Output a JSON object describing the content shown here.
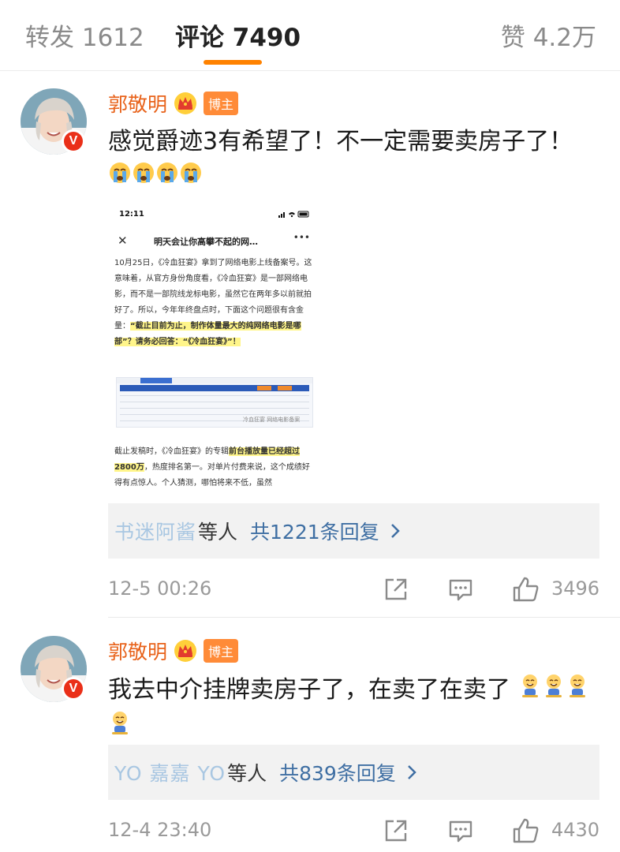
{
  "tabs": {
    "repost": "转发 1612",
    "comments": "评论 7490",
    "likes": "赞 4.2万",
    "active": "comments"
  },
  "comments": [
    {
      "username": "郭敬明",
      "badge": "博主",
      "text": "感觉爵迹3有希望了！不一定需要卖房子了！",
      "emoji_count": 4,
      "emoji_type": "crying-face",
      "image": {
        "status_time": "12:11",
        "nav_title": "明天会让你高攀不起的网…",
        "para1": "10月25日，《冷血狂宴》拿到了网络电影上线备案号。这意味着，从官方身份角度看，《冷血狂宴》是一部网络电影，而不是一部院线龙标电影，虽然它在两年多以前就拍好了。所以，今年年终盘点时，下面这个问题很有含金量：",
        "para1_highlight": "“截止目前为止，制作体量最大的纯网络电影是哪部”？请务必回答：“《冷血狂宴》”！",
        "web_caption": "冷血狂宴 网络电影备案",
        "para2_a": "截止发稿时，《冷血狂宴》的专辑",
        "para2_highlight": "前台播放量已经超过2800万",
        "para2_b": "，热度排名第一。对单片付费来说，这个成绩好得有点惊人。个人猜测，哪怕将来不低，虽然"
      },
      "replies": {
        "names": "书迷阿酱",
        "etc": "等人",
        "count": "共1221条回复"
      },
      "time": "12-5 00:26",
      "likes": "3496"
    },
    {
      "username": "郭敬明",
      "badge": "博主",
      "text": "我去中介挂牌卖房子了，在卖了在卖了",
      "emoji_count": 4,
      "emoji_type": "grinning-doll",
      "replies": {
        "names": "YO 嘉嘉 YO",
        "etc": "等人",
        "count": "共839条回复"
      },
      "time": "12-4 23:40",
      "likes": "4430"
    }
  ],
  "colors": {
    "accent": "#ff8200",
    "username": "#e8621a",
    "link": "#3f6fa3",
    "muted": "#9a9a9a",
    "badge": "#ff8b38"
  }
}
